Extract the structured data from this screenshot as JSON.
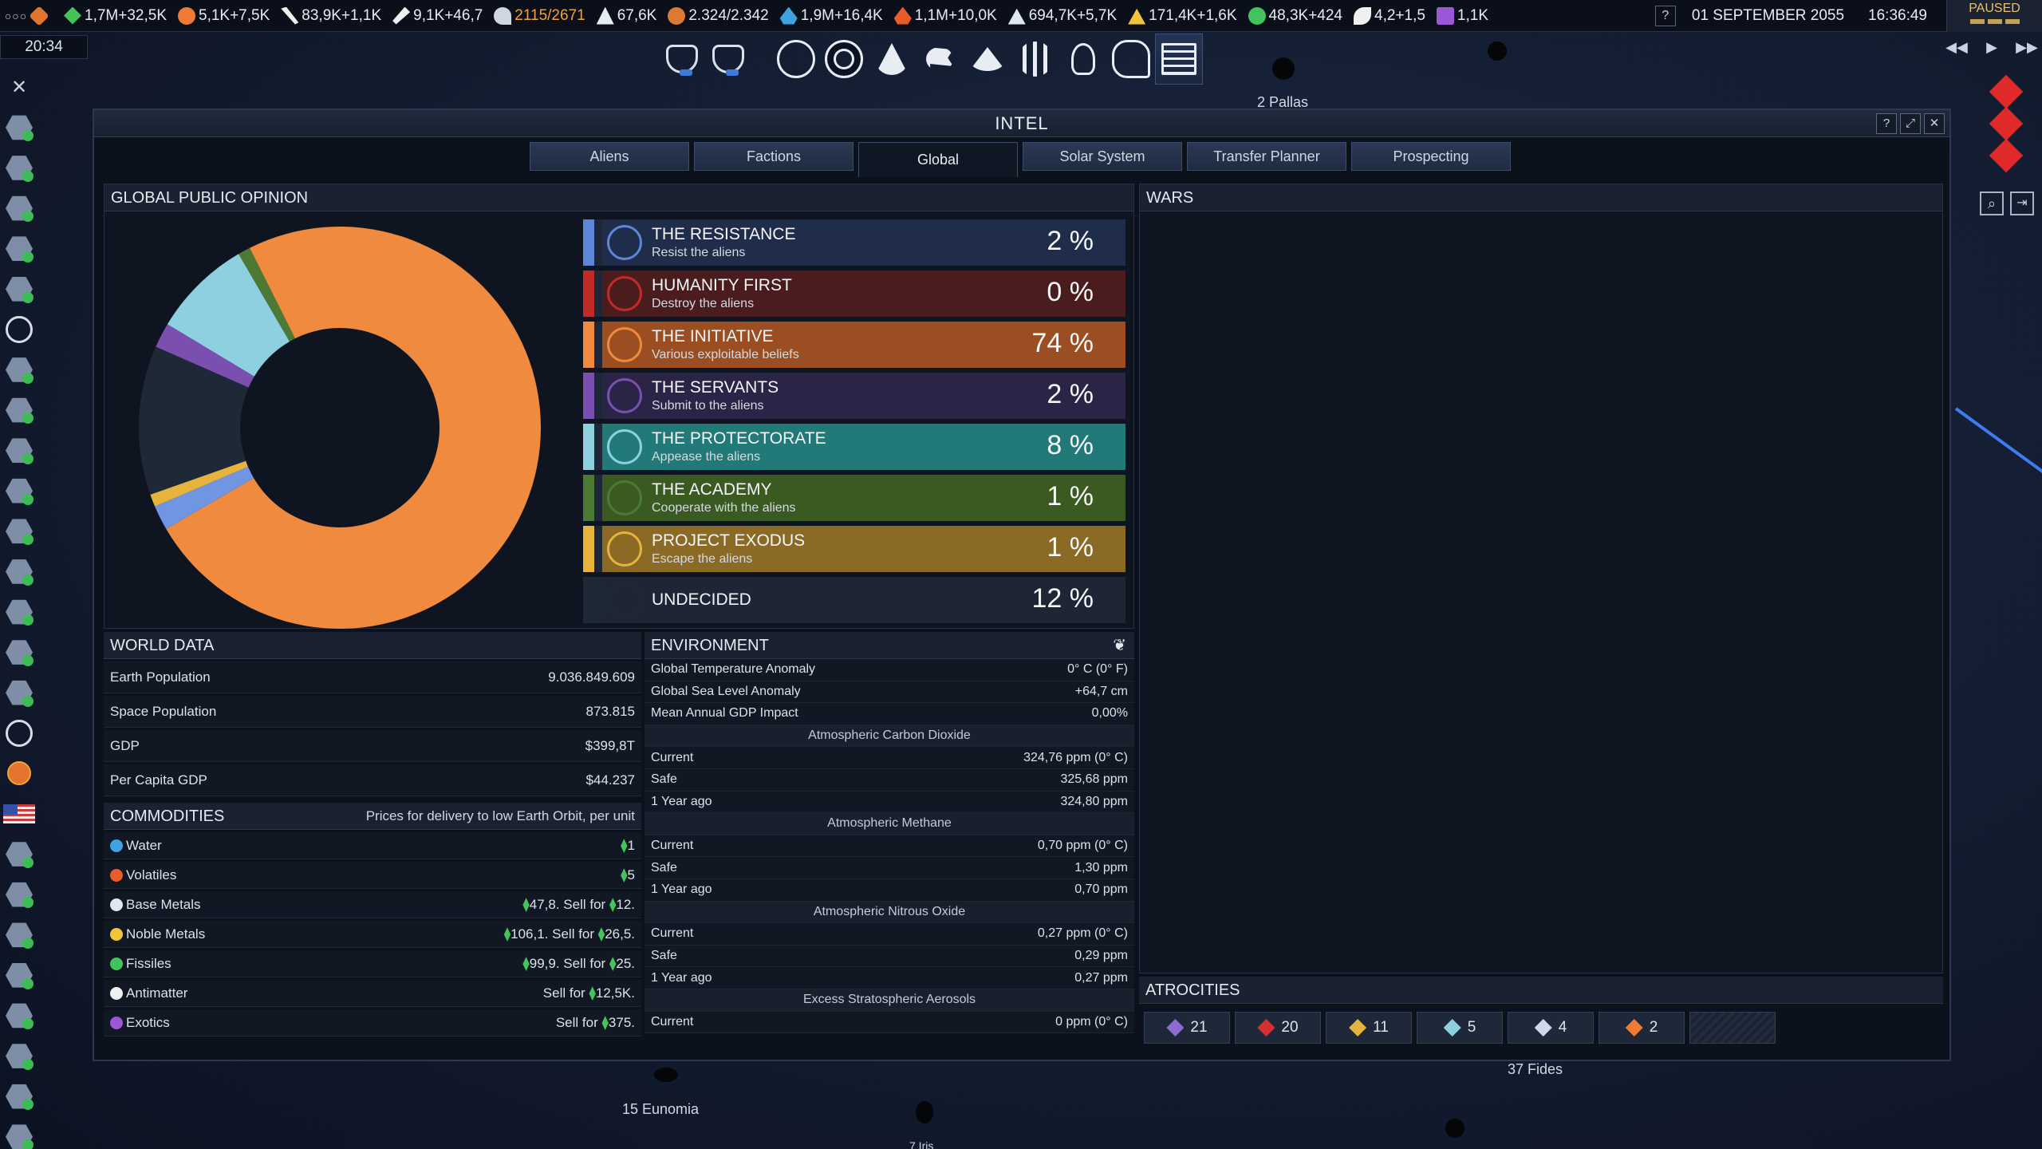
{
  "topbar": {
    "resources": [
      {
        "id": "influence",
        "text": "1,7M+32,5K",
        "icon": "green-diamond-icon",
        "cls": "g"
      },
      {
        "id": "ops",
        "text": "5,1K+7,5K",
        "icon": "burst-icon",
        "cls": "o"
      },
      {
        "id": "boost",
        "text": "83,9K+1,1K",
        "icon": "swords-icon",
        "cls": "w"
      },
      {
        "id": "missions",
        "text": "9,1K+46,7",
        "icon": "rocket-icon",
        "cls": "r"
      },
      {
        "id": "control",
        "text": "2115/2671",
        "icon": "antenna-icon",
        "cls": "s",
        "highlight": true
      },
      {
        "id": "research",
        "text": "67,6K",
        "icon": "scientist-icon",
        "cls": "p"
      },
      {
        "id": "cp",
        "text": "2.324/2.342",
        "icon": "control-point-icon",
        "cls": "c"
      },
      {
        "id": "water",
        "text": "1,9M+16,4K",
        "icon": "water-drop-icon",
        "cls": "b"
      },
      {
        "id": "volatiles",
        "text": "1,1M+10,0K",
        "icon": "volatiles-icon",
        "cls": "f"
      },
      {
        "id": "metals",
        "text": "694,7K+5,7K",
        "icon": "base-metals-icon",
        "cls": "m"
      },
      {
        "id": "noble",
        "text": "171,4K+1,6K",
        "icon": "noble-metals-icon",
        "cls": "y"
      },
      {
        "id": "fissiles",
        "text": "48,3K+424",
        "icon": "fissiles-icon",
        "cls": "n"
      },
      {
        "id": "antimatter",
        "text": "4,2+1,5",
        "icon": "antimatter-icon",
        "cls": "a"
      },
      {
        "id": "exotics",
        "text": "1,1K",
        "icon": "exotics-icon",
        "cls": "e"
      }
    ],
    "menu": "○○○",
    "help": "?",
    "date": "01 SEPTEMBER 2055",
    "time": "16:36:49",
    "paused": "PAUSED"
  },
  "subclock": "20:34",
  "speed": [
    "◀◀",
    "▶",
    "▶▶"
  ],
  "intel": {
    "title": "INTEL",
    "window_buttons": [
      "?",
      "⤢",
      "✕"
    ],
    "tabs": [
      "Aliens",
      "Factions",
      "Global",
      "Solar System",
      "Transfer Planner",
      "Prospecting"
    ],
    "active_tab": 2,
    "opinion": {
      "header": "GLOBAL PUBLIC OPINION",
      "factions": [
        {
          "name": "THE RESISTANCE",
          "sub": "Resist the aliens",
          "pct": "2 %",
          "color": "#5c86d8",
          "bg": "#1f2d4a"
        },
        {
          "name": "HUMANITY FIRST",
          "sub": "Destroy the aliens",
          "pct": "0 %",
          "color": "#c22a2a",
          "bg": "#4a1c1e"
        },
        {
          "name": "THE INITIATIVE",
          "sub": "Various exploitable beliefs",
          "pct": "74 %",
          "color": "#ef8a3e",
          "bg": "#9a4e22"
        },
        {
          "name": "THE SERVANTS",
          "sub": "Submit to the aliens",
          "pct": "2 %",
          "color": "#7a4fb0",
          "bg": "#2a2446"
        },
        {
          "name": "THE PROTECTORATE",
          "sub": "Appease the aliens",
          "pct": "8 %",
          "color": "#8ed0df",
          "bg": "#227a78"
        },
        {
          "name": "THE ACADEMY",
          "sub": "Cooperate with the aliens",
          "pct": "1 %",
          "color": "#4c7a34",
          "bg": "#3b5a22"
        },
        {
          "name": "PROJECT EXODUS",
          "sub": "Escape the aliens",
          "pct": "1 %",
          "color": "#e6b33c",
          "bg": "#8a6a24"
        },
        {
          "name": "UNDECIDED",
          "sub": "",
          "pct": "12 %",
          "color": "#1f2836",
          "bg": "#1e2534"
        }
      ]
    },
    "world": {
      "header": "WORLD DATA",
      "rows": [
        {
          "k": "Earth Population",
          "v": "9.036.849.609"
        },
        {
          "k": "Space Population",
          "v": "873.815"
        },
        {
          "k": "GDP",
          "v": "$399,8T"
        },
        {
          "k": "Per Capita GDP",
          "v": "$44.237"
        }
      ]
    },
    "commodities": {
      "header": "COMMODITIES",
      "note": "Prices for delivery to low Earth Orbit, per unit",
      "rows": [
        {
          "k": "Water",
          "icon": "water-icon",
          "color": "#3fa3e0",
          "price": "1",
          "sell": ""
        },
        {
          "k": "Volatiles",
          "icon": "volatiles-icon",
          "color": "#e85c2a",
          "price": "5",
          "sell": ""
        },
        {
          "k": "Base Metals",
          "icon": "base-metals-icon",
          "color": "#dfe7f0",
          "price": "47,8",
          "sell": "12."
        },
        {
          "k": "Noble Metals",
          "icon": "noble-metals-icon",
          "color": "#f0c53a",
          "price": "106,1",
          "sell": "26,5."
        },
        {
          "k": "Fissiles",
          "icon": "fissiles-icon",
          "color": "#42c45c",
          "price": "99,9",
          "sell": "25."
        },
        {
          "k": "Antimatter",
          "icon": "antimatter-icon",
          "color": "#f0f0f0",
          "price": "",
          "sell": "12,5K."
        },
        {
          "k": "Exotics",
          "icon": "exotics-icon",
          "color": "#9a58d6",
          "price": "",
          "sell": "375."
        }
      ],
      "sell_label": "Sell for"
    },
    "environment": {
      "header": "ENVIRONMENT",
      "rows": [
        {
          "k": "Global Temperature Anomaly",
          "v": "0° C (0° F)"
        },
        {
          "k": "Global Sea Level Anomaly",
          "v": "+64,7 cm"
        },
        {
          "k": "Mean Annual GDP Impact",
          "v": "0,00%"
        },
        {
          "sub": "Atmospheric Carbon Dioxide"
        },
        {
          "k": "Current",
          "v": "324,76 ppm (0° C)"
        },
        {
          "k": "Safe",
          "v": "325,68 ppm"
        },
        {
          "k": "1 Year ago",
          "v": "324,80 ppm"
        },
        {
          "sub": "Atmospheric Methane"
        },
        {
          "k": "Current",
          "v": "0,70 ppm (0° C)"
        },
        {
          "k": "Safe",
          "v": "1,30 ppm"
        },
        {
          "k": "1 Year ago",
          "v": "0,70 ppm"
        },
        {
          "sub": "Atmospheric Nitrous Oxide"
        },
        {
          "k": "Current",
          "v": "0,27 ppm (0° C)"
        },
        {
          "k": "Safe",
          "v": "0,29 ppm"
        },
        {
          "k": "1 Year ago",
          "v": "0,27 ppm"
        },
        {
          "sub": "Excess Stratospheric Aerosols"
        },
        {
          "k": "Current",
          "v": "0 ppm (0° C)"
        }
      ]
    },
    "wars": {
      "header": "WARS"
    },
    "atrocities": {
      "header": "ATROCITIES",
      "items": [
        {
          "v": "21",
          "icon": "servants-icon",
          "color": "#8d6dd0"
        },
        {
          "v": "20",
          "icon": "humanity-first-icon",
          "color": "#d63030"
        },
        {
          "v": "11",
          "icon": "exodus-icon",
          "color": "#e6b33c"
        },
        {
          "v": "5",
          "icon": "protectorate-icon",
          "color": "#8ed0df"
        },
        {
          "v": "4",
          "icon": "resistance-icon",
          "color": "#cfd9ea"
        },
        {
          "v": "2",
          "icon": "initiative-icon",
          "color": "#ef7a33"
        }
      ]
    }
  },
  "chart_data": {
    "type": "pie",
    "donut": true,
    "categories": [
      "The Initiative",
      "The Resistance",
      "Exodus",
      "Undecided",
      "The Servants",
      "The Protectorate",
      "The Academy"
    ],
    "values": [
      74,
      2,
      1,
      12,
      2,
      8,
      1
    ],
    "colors": [
      "#ef8a3e",
      "#6f95e3",
      "#e6b33c",
      "#1f2836",
      "#7a4fb0",
      "#8ed0df",
      "#4c7a34"
    ]
  },
  "map": {
    "labels": [
      "15 Eunomia",
      "37 Fides",
      "2 Pallas",
      "7 Iris"
    ]
  }
}
